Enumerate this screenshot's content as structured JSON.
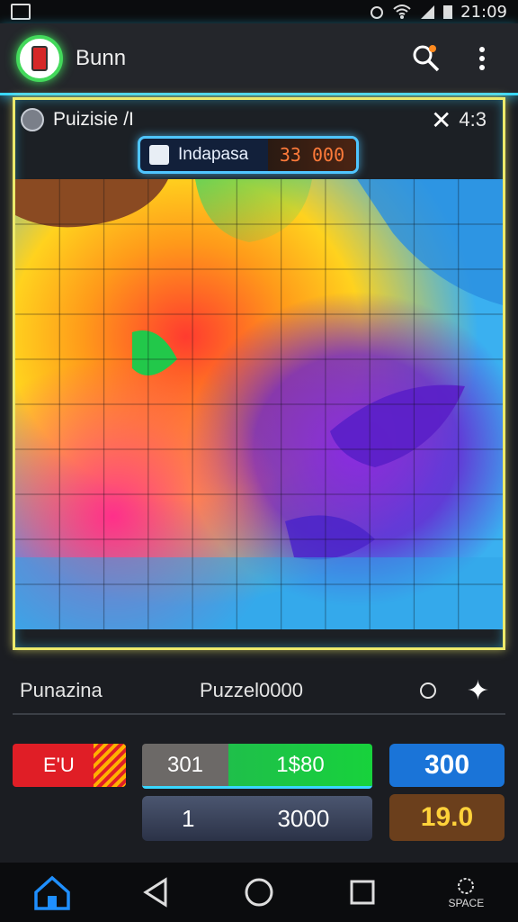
{
  "status": {
    "time": "21:09"
  },
  "app": {
    "title": "Bunn"
  },
  "panel": {
    "title": "Puizisie /I",
    "timer": "4:3",
    "chip_label": "Indapasa",
    "chip_value": "33 000"
  },
  "footer": {
    "left": "Punazina",
    "center": "Puzzel0000"
  },
  "stats": {
    "red_label": "E'U",
    "mid_left": "301",
    "mid_right": "1$80",
    "bottom_left": "1",
    "bottom_right": "3000",
    "blue_value": "300",
    "gold_value": "19.0"
  },
  "nav": {
    "space_label": "SPACE"
  },
  "colors": {
    "accent_cyan": "#39d7ff",
    "panel_yellow": "#ecea6b",
    "red": "#e01e26",
    "green": "#17d23c",
    "blue": "#1a74d8",
    "gold": "#ffd23a"
  },
  "icons": {
    "search": "search-icon",
    "menu": "more-vert-icon",
    "close": "close-icon",
    "home": "home-icon",
    "back": "back-icon",
    "circle": "circle-icon",
    "square": "square-icon",
    "star": "sparkle-icon"
  }
}
